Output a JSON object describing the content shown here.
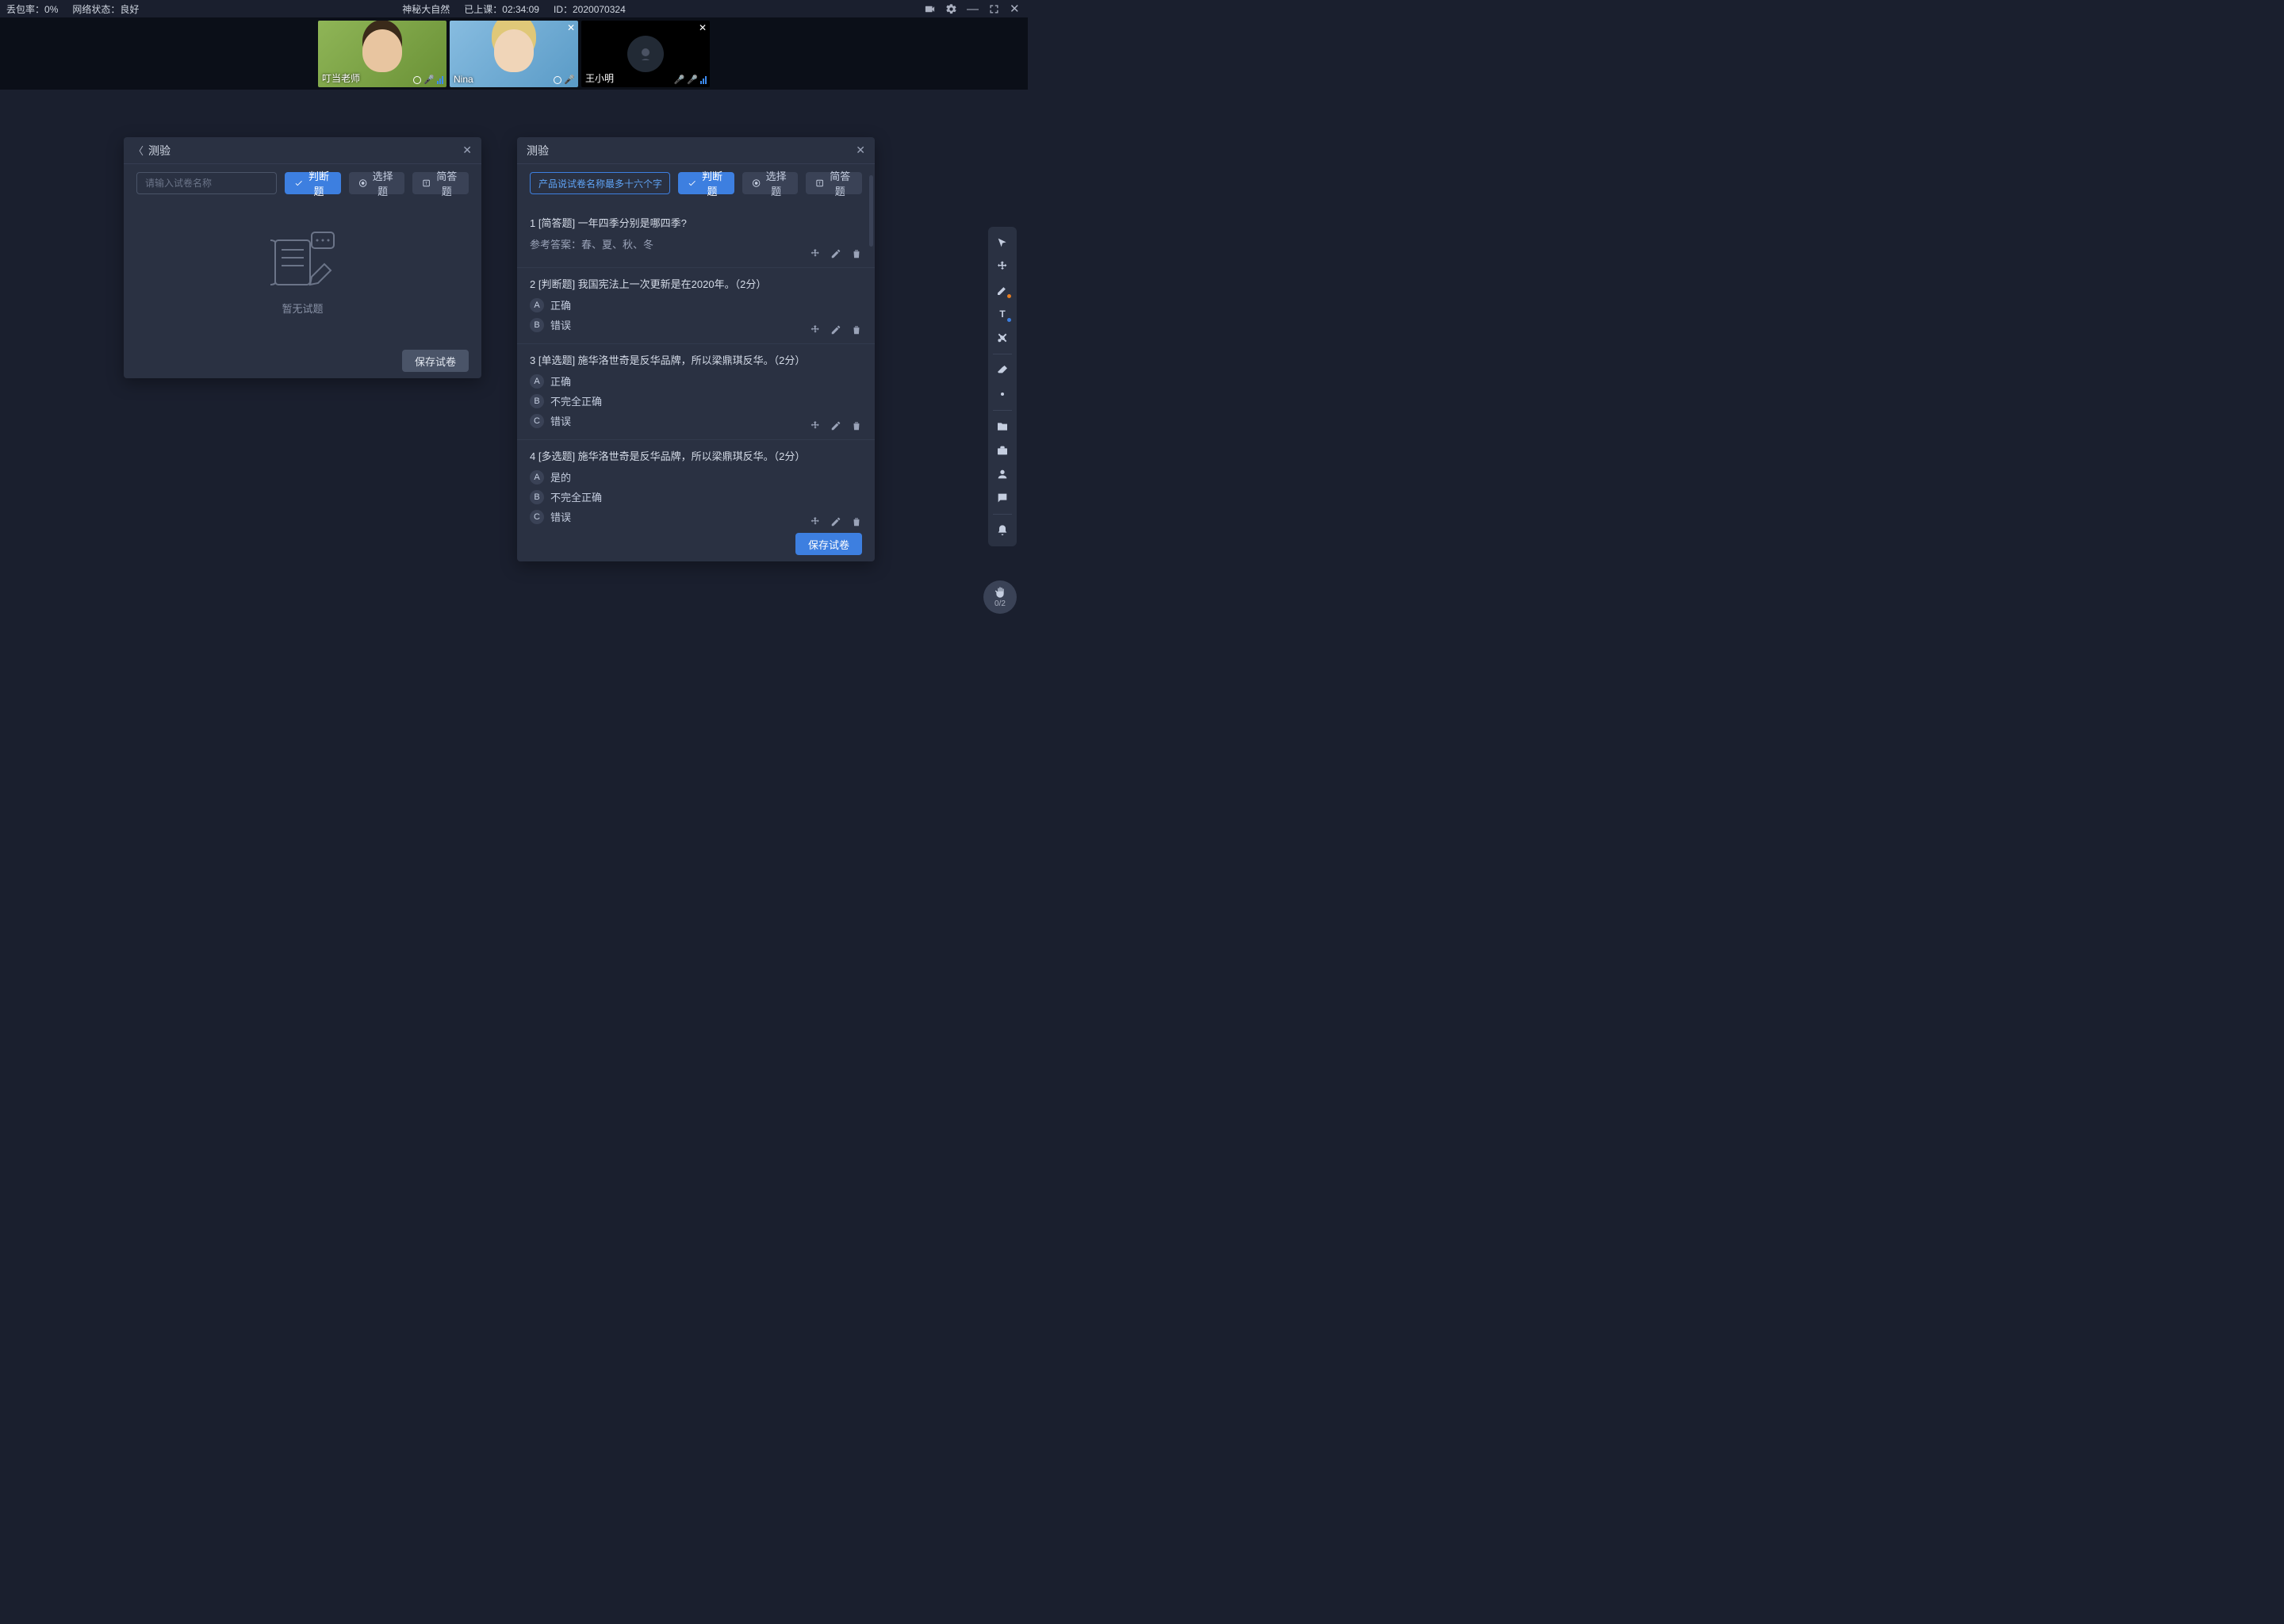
{
  "status": {
    "packet_loss_label": "丢包率：",
    "packet_loss_value": "0%",
    "network_label": "网络状态：",
    "network_value": "良好",
    "course_name": "神秘大自然",
    "elapsed_label": "已上课：",
    "elapsed_value": "02:34:09",
    "id_label": "ID：",
    "id_value": "2020070324"
  },
  "videos": [
    {
      "name": "叮当老师",
      "mic": "on",
      "closeable": false,
      "dark": false,
      "kind": "teacher"
    },
    {
      "name": "Nina",
      "mic": "on",
      "closeable": true,
      "dark": false,
      "kind": "nina"
    },
    {
      "name": "王小明",
      "mic": "mix",
      "closeable": true,
      "dark": true,
      "kind": "dark"
    }
  ],
  "panel_left": {
    "title": "测验",
    "input_placeholder": "请输入试卷名称",
    "buttons": {
      "judge": "判断题",
      "choice": "选择题",
      "short": "简答题"
    },
    "empty_label": "暂无试题",
    "save_label": "保存试卷"
  },
  "panel_right": {
    "title": "测验",
    "name_value": "产品说试卷名称最多十六个字",
    "buttons": {
      "judge": "判断题",
      "choice": "选择题",
      "short": "简答题"
    },
    "save_label": "保存试卷",
    "answer_ref_prefix": "参考答案：",
    "questions": [
      {
        "heading": "1 [简答题] 一年四季分别是哪四季?",
        "answer_ref": "春、夏、秋、冬",
        "options": []
      },
      {
        "heading": "2 [判断题] 我国宪法上一次更新是在2020年。（2分）",
        "options": [
          {
            "letter": "A",
            "text": "正确"
          },
          {
            "letter": "B",
            "text": "错误"
          }
        ]
      },
      {
        "heading": "3 [单选题] 施华洛世奇是反华品牌，所以梁鼎琪反华。（2分）",
        "options": [
          {
            "letter": "A",
            "text": "正确"
          },
          {
            "letter": "B",
            "text": "不完全正确"
          },
          {
            "letter": "C",
            "text": "错误"
          }
        ]
      },
      {
        "heading": "4 [多选题] 施华洛世奇是反华品牌，所以梁鼎琪反华。（2分）",
        "options": [
          {
            "letter": "A",
            "text": "是的"
          },
          {
            "letter": "B",
            "text": "不完全正确"
          },
          {
            "letter": "C",
            "text": "错误"
          }
        ]
      }
    ]
  },
  "hand_badge": {
    "count": "0/2"
  }
}
